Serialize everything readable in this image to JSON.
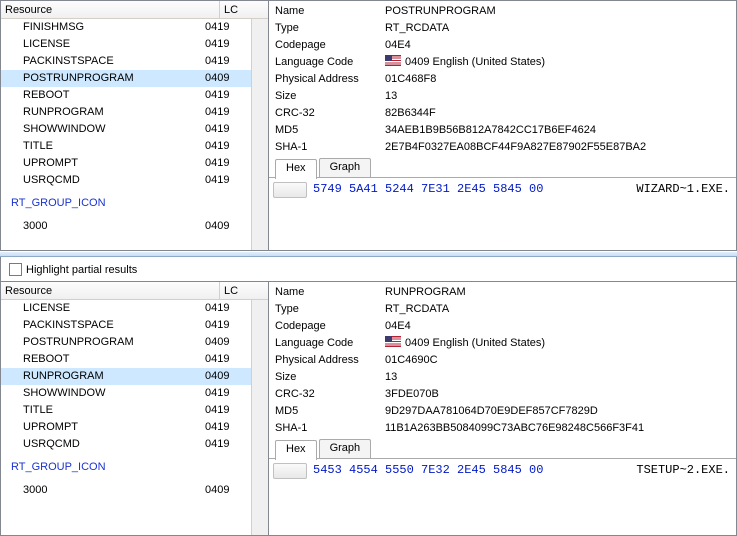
{
  "pane1": {
    "headers": {
      "resource": "Resource",
      "lc": "LC"
    },
    "items": [
      {
        "label": "FINISHMSG",
        "lc": "0419",
        "indent": 1,
        "selected": false
      },
      {
        "label": "LICENSE",
        "lc": "0419",
        "indent": 1,
        "selected": false
      },
      {
        "label": "PACKINSTSPACE",
        "lc": "0419",
        "indent": 1,
        "selected": false
      },
      {
        "label": "POSTRUNPROGRAM",
        "lc": "0409",
        "indent": 1,
        "selected": true
      },
      {
        "label": "REBOOT",
        "lc": "0419",
        "indent": 1,
        "selected": false
      },
      {
        "label": "RUNPROGRAM",
        "lc": "0419",
        "indent": 1,
        "selected": false
      },
      {
        "label": "SHOWWINDOW",
        "lc": "0419",
        "indent": 1,
        "selected": false
      },
      {
        "label": "TITLE",
        "lc": "0419",
        "indent": 1,
        "selected": false
      },
      {
        "label": "UPROMPT",
        "lc": "0419",
        "indent": 1,
        "selected": false
      },
      {
        "label": "USRQCMD",
        "lc": "0419",
        "indent": 1,
        "selected": false
      }
    ],
    "group": {
      "label": "RT_GROUP_ICON"
    },
    "groupItem": {
      "label": "3000",
      "lc": "0409"
    },
    "props": {
      "name_k": "Name",
      "name_v": "POSTRUNPROGRAM",
      "type_k": "Type",
      "type_v": "RT_RCDATA",
      "codepage_k": "Codepage",
      "codepage_v": "04E4",
      "lang_k": "Language Code",
      "lang_v": "0409 English (United States)",
      "paddr_k": "Physical Address",
      "paddr_v": "01C468F8",
      "size_k": "Size",
      "size_v": "13",
      "crc_k": "CRC-32",
      "crc_v": "82B6344F",
      "md5_k": "MD5",
      "md5_v": "34AEB1B9B56B812A7842CC17B6EF4624",
      "sha1_k": "SHA-1",
      "sha1_v": "2E7B4F0327EA08BCF44F9A827E87902F55E87BA2"
    },
    "tabs": {
      "hex": "Hex",
      "graph": "Graph"
    },
    "hex": {
      "bytes": "5749 5A41 5244 7E31 2E45 5845 00",
      "ascii": "WIZARD~1.EXE."
    }
  },
  "highlight_label": "Highlight partial results",
  "pane2": {
    "headers": {
      "resource": "Resource",
      "lc": "LC"
    },
    "items": [
      {
        "label": "LICENSE",
        "lc": "0419",
        "indent": 1,
        "selected": false
      },
      {
        "label": "PACKINSTSPACE",
        "lc": "0419",
        "indent": 1,
        "selected": false
      },
      {
        "label": "POSTRUNPROGRAM",
        "lc": "0409",
        "indent": 1,
        "selected": false
      },
      {
        "label": "REBOOT",
        "lc": "0419",
        "indent": 1,
        "selected": false
      },
      {
        "label": "RUNPROGRAM",
        "lc": "0409",
        "indent": 1,
        "selected": true
      },
      {
        "label": "SHOWWINDOW",
        "lc": "0419",
        "indent": 1,
        "selected": false
      },
      {
        "label": "TITLE",
        "lc": "0419",
        "indent": 1,
        "selected": false
      },
      {
        "label": "UPROMPT",
        "lc": "0419",
        "indent": 1,
        "selected": false
      },
      {
        "label": "USRQCMD",
        "lc": "0419",
        "indent": 1,
        "selected": false
      }
    ],
    "group": {
      "label": "RT_GROUP_ICON"
    },
    "groupItem": {
      "label": "3000",
      "lc": "0409"
    },
    "props": {
      "name_k": "Name",
      "name_v": "RUNPROGRAM",
      "type_k": "Type",
      "type_v": "RT_RCDATA",
      "codepage_k": "Codepage",
      "codepage_v": "04E4",
      "lang_k": "Language Code",
      "lang_v": "0409 English (United States)",
      "paddr_k": "Physical Address",
      "paddr_v": "01C4690C",
      "size_k": "Size",
      "size_v": "13",
      "crc_k": "CRC-32",
      "crc_v": "3FDE070B",
      "md5_k": "MD5",
      "md5_v": "9D297DAA781064D70E9DEF857CF7829D",
      "sha1_k": "SHA-1",
      "sha1_v": "11B1A263BB5084099C73ABC76E98248C566F3F41"
    },
    "tabs": {
      "hex": "Hex",
      "graph": "Graph"
    },
    "hex": {
      "bytes": "5453 4554 5550 7E32 2E45 5845 00",
      "ascii": "TSETUP~2.EXE."
    }
  }
}
